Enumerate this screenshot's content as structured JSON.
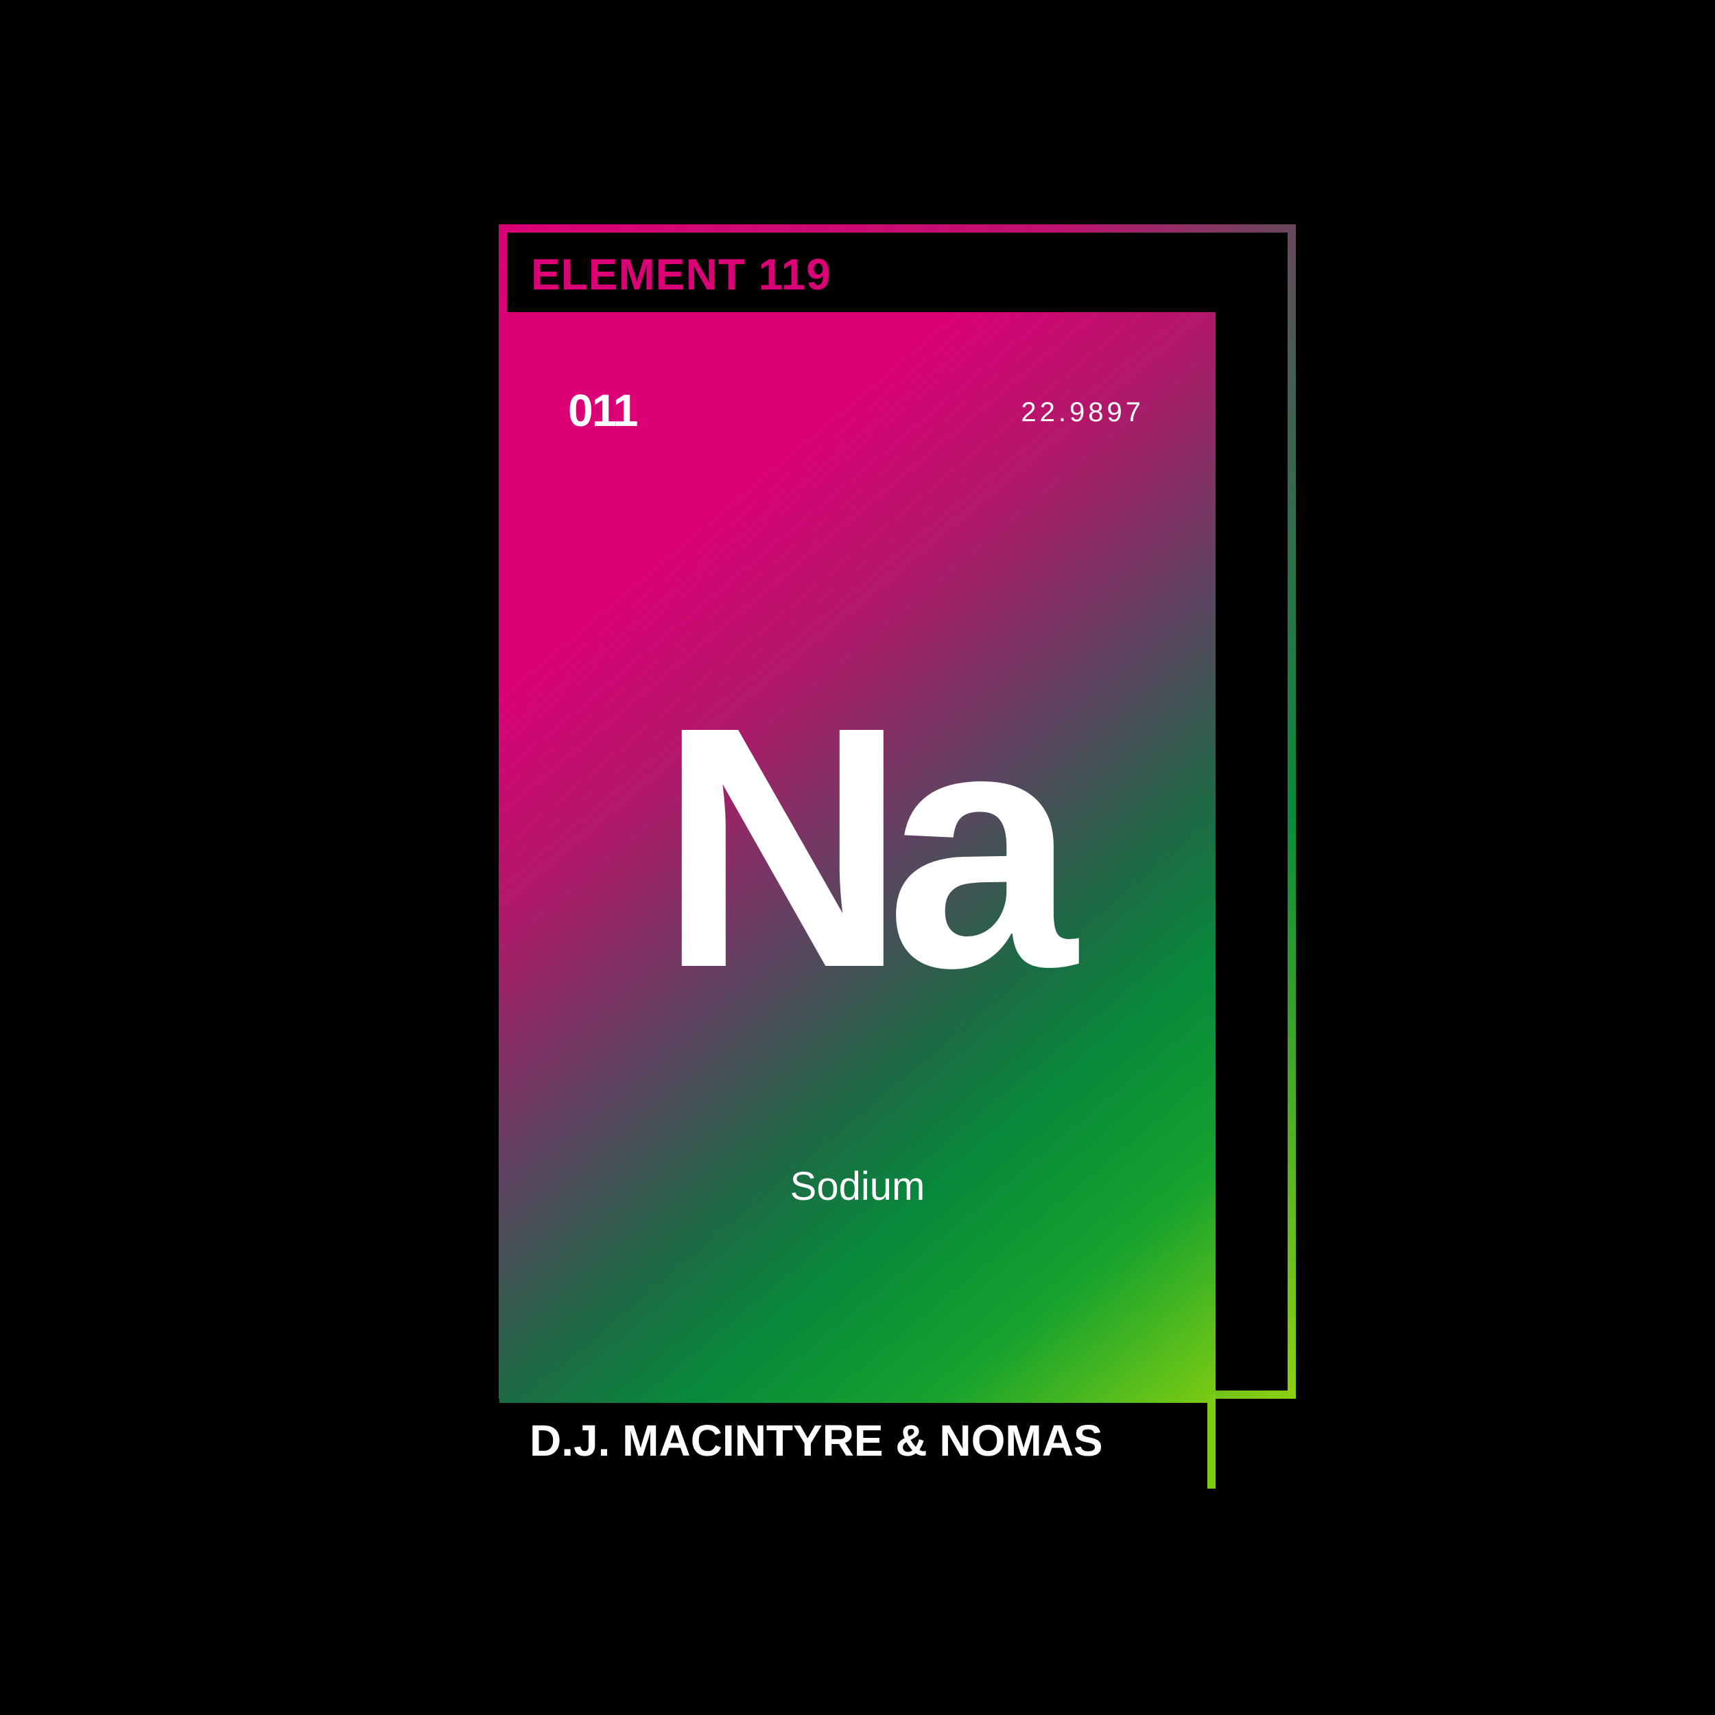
{
  "cover": {
    "series_label": "ELEMENT 119",
    "atomic_number": "011",
    "atomic_mass": "22.9897",
    "symbol": "Na",
    "element_name": "Sodium",
    "artist": "D.J. MACINTYRE & NOMAS"
  },
  "colors": {
    "background": "#000000",
    "magenta": "#dc0077",
    "green": "#078a3a",
    "lime": "#7ccc12",
    "text": "#ffffff"
  }
}
